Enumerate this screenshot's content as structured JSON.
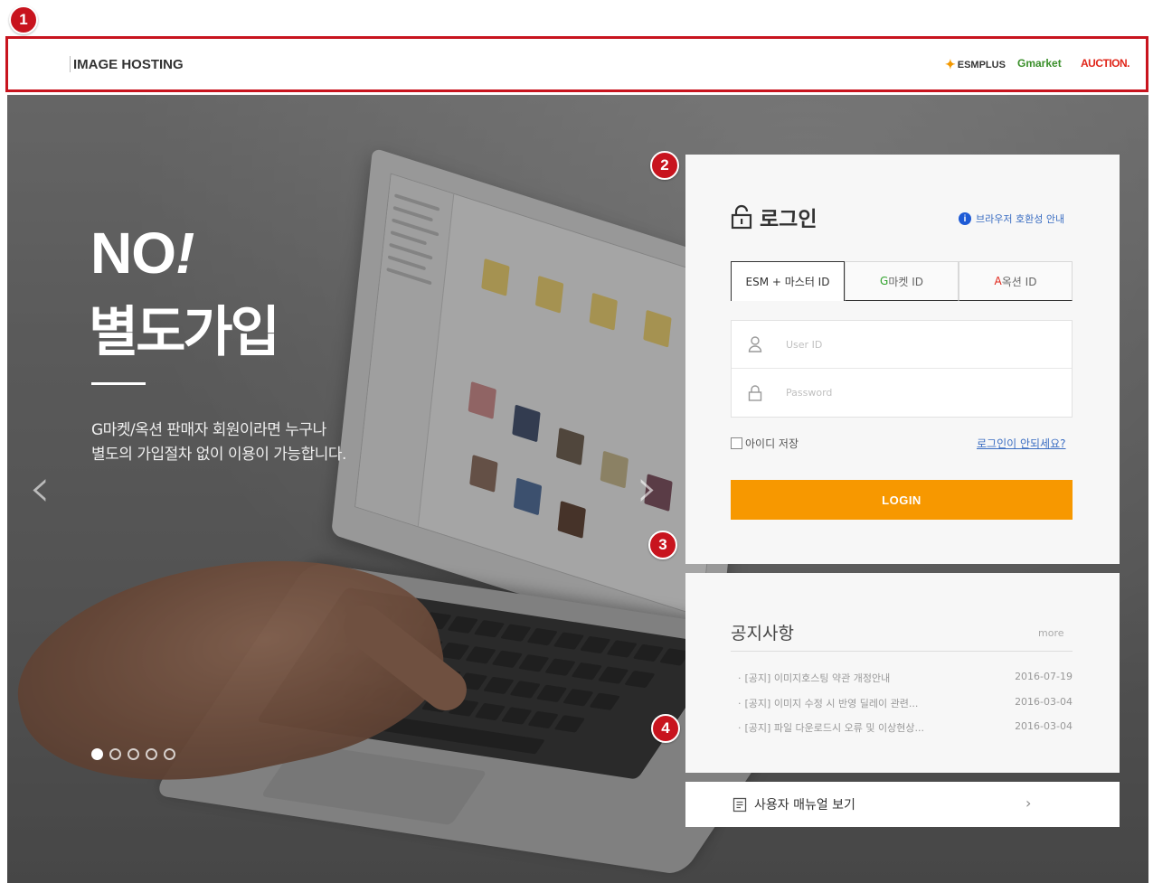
{
  "markers": [
    "1",
    "2",
    "3",
    "4"
  ],
  "header": {
    "brand": "IMAGE HOSTING",
    "partner_logos": [
      "ESMPLUS",
      "Gmarket",
      "AUCTION."
    ]
  },
  "hero": {
    "headline_no": "NO",
    "headline_exclaim": "!",
    "headline_title": "별도가입",
    "desc_line1": "G마켓/옥션 판매자 회원이라면 누구나",
    "desc_line2": "별도의 가입절차 없이 이용이 가능합니다.",
    "slide_count": 5,
    "active_slide": 1
  },
  "login": {
    "title": "로그인",
    "compat_link": "브라우저 호환성 안내",
    "tabs": [
      {
        "label": "ESM + 마스터 ID",
        "active": true
      },
      {
        "label_prefix": "G",
        "label_rest": "마켓 ID",
        "active": false
      },
      {
        "label_prefix": "A",
        "label_rest": "옥션 ID",
        "active": false
      }
    ],
    "userid_placeholder": "User ID",
    "password_placeholder": "Password",
    "remember_label": "아이디 저장",
    "forgot_link": "로그인이 안되세요?",
    "button_label": "LOGIN"
  },
  "notice": {
    "title": "공지사항",
    "more": "more",
    "items": [
      {
        "text": "[공지] 이미지호스팅 약관 개정안내",
        "date": "2016-07-19"
      },
      {
        "text": "[공지] 이미지 수정 시 반영 딜레이 관련...",
        "date": "2016-03-04"
      },
      {
        "text": "[공지] 파일 다운로드시 오류 및 이상현상...",
        "date": "2016-03-04"
      }
    ]
  },
  "manual": {
    "label": "사용자 매뉴얼 보기",
    "chevron": "›"
  },
  "colors": {
    "accent_red": "#c8141e",
    "login_orange": "#f79800",
    "link_blue": "#3a6dc2"
  }
}
